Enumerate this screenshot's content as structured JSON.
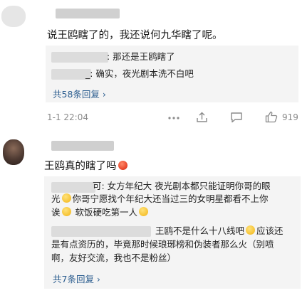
{
  "comment1": {
    "text": "说王鸥瞎了的，我还说何九华瞎了呢。",
    "replies": [
      {
        "text": ": 那还是王鸥瞎了"
      },
      {
        "text": "_: 确实，夜光剧本洗不白吧"
      }
    ],
    "more_link": "共58条回复 ›",
    "timestamp": "1-1 22:04",
    "like_count": "919"
  },
  "comment2": {
    "text": "王鸥真的瞎了吗",
    "replies": [
      {
        "lines": [
          "可: 女方年纪大 夜光剧本都只能证明你哥的眼",
          "光",
          "你哥宁愿找个年纪大还当过三的女明星都看不上你",
          "诶",
          "软饭硬吃第一人"
        ]
      },
      {
        "lines": [
          "王鸥不是什么十八线吧",
          "应该还",
          "是有点资历的，毕竟那时候琅琊榜和伪装者那么火（别喷",
          "啊，友好交流，我也不是粉丝）"
        ]
      }
    ],
    "more_link": "共7条回复 ›"
  },
  "icons": [
    "more-dots-icon",
    "share-icon",
    "comment-icon",
    "like-icon"
  ],
  "colors": {
    "link": "#2b5d8f",
    "reply_bg": "#f4f4f4",
    "meta": "#8a8a8a"
  }
}
